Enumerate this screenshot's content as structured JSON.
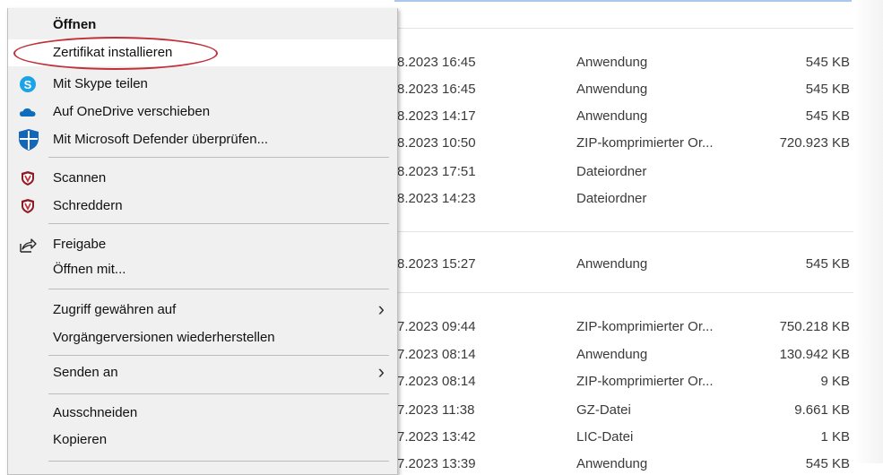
{
  "menu": {
    "items": [
      {
        "label": "Öffnen",
        "icon": ""
      },
      {
        "label": "Zertifikat installieren",
        "icon": ""
      },
      {
        "label": "Mit Skype teilen",
        "icon": "skype-icon"
      },
      {
        "label": "Auf OneDrive verschieben",
        "icon": "onedrive-cloud-icon"
      },
      {
        "label": "Mit Microsoft Defender überprüfen...",
        "icon": "defender-shield-icon"
      },
      {
        "label": "Scannen",
        "icon": "antivirus-shield-icon"
      },
      {
        "label": "Schreddern",
        "icon": "antivirus-shield-icon"
      },
      {
        "label": "Freigabe",
        "icon": "share-icon"
      },
      {
        "label": "Öffnen mit...",
        "icon": ""
      },
      {
        "label": "Zugriff gewähren auf",
        "icon": "chevron-right-icon"
      },
      {
        "label": "Vorgängerversionen wiederherstellen",
        "icon": ""
      },
      {
        "label": "Senden an",
        "icon": "chevron-right-icon"
      },
      {
        "label": "Ausschneiden",
        "icon": ""
      },
      {
        "label": "Kopieren",
        "icon": ""
      }
    ],
    "highlighted": "Zertifikat installieren",
    "annotation_color": "#c0313b"
  },
  "files": {
    "rows": [
      {
        "date": "8.2023 16:45",
        "type": "Anwendung",
        "size": "545 KB"
      },
      {
        "date": "8.2023 16:45",
        "type": "Anwendung",
        "size": "545 KB"
      },
      {
        "date": "8.2023 14:17",
        "type": "Anwendung",
        "size": "545 KB"
      },
      {
        "date": "8.2023 10:50",
        "type": "ZIP-komprimierter Or...",
        "size": "720.923 KB"
      },
      {
        "date": "8.2023 17:51",
        "type": "Dateiordner",
        "size": ""
      },
      {
        "date": "8.2023 14:23",
        "type": "Dateiordner",
        "size": ""
      },
      {
        "date": "8.2023 15:27",
        "type": "Anwendung",
        "size": "545 KB"
      },
      {
        "date": "7.2023 09:44",
        "type": "ZIP-komprimierter Or...",
        "size": "750.218 KB"
      },
      {
        "date": "7.2023 08:14",
        "type": "Anwendung",
        "size": "130.942 KB"
      },
      {
        "date": "7.2023 08:14",
        "type": "ZIP-komprimierter Or...",
        "size": "9 KB"
      },
      {
        "date": "7.2023 11:38",
        "type": "GZ-Datei",
        "size": "9.661 KB"
      },
      {
        "date": "7.2023 13:42",
        "type": "LIC-Datei",
        "size": "1 KB"
      },
      {
        "date": "7.2023 13:39",
        "type": "Anwendung",
        "size": "545 KB"
      }
    ]
  }
}
